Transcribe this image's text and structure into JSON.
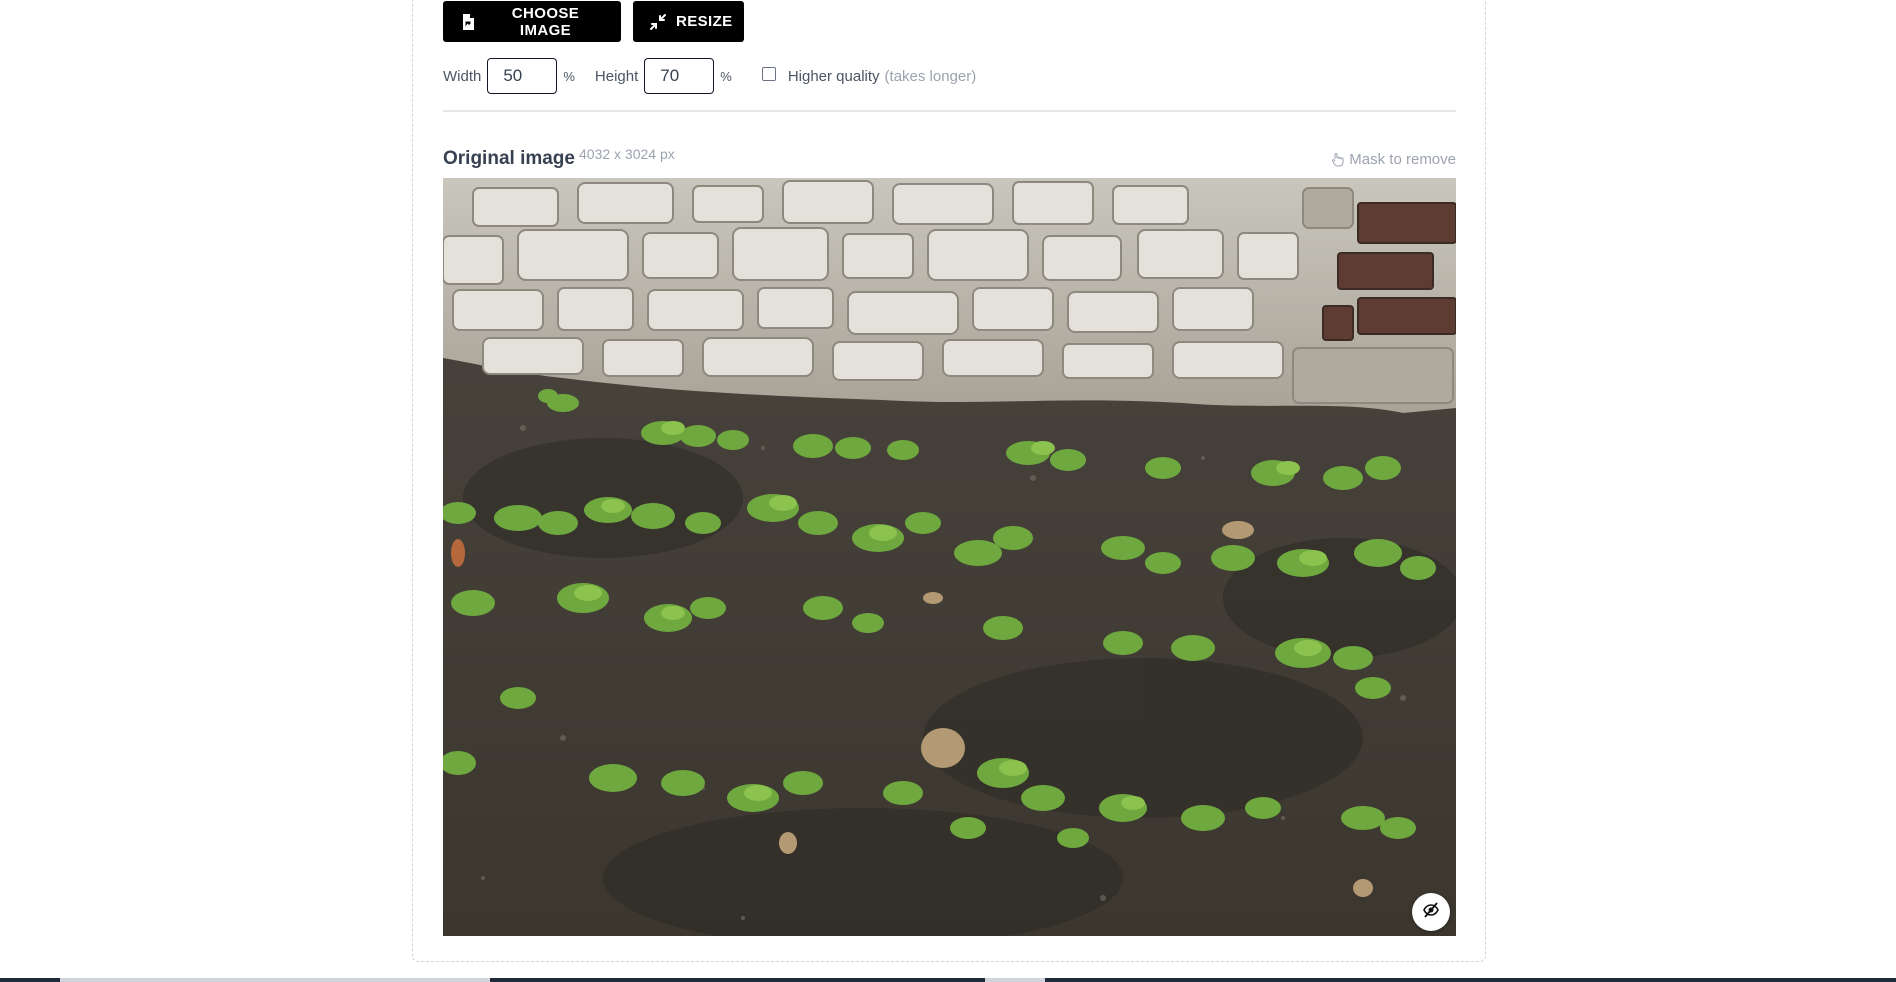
{
  "toolbar": {
    "choose_label": "CHOOSE IMAGE",
    "resize_label": "RESIZE"
  },
  "options": {
    "width_label": "Width",
    "width_value": "50",
    "width_unit": "%",
    "height_label": "Height",
    "height_value": "70",
    "height_unit": "%",
    "quality_label": "Higher quality",
    "quality_note": "(takes longer)",
    "quality_checked": false
  },
  "original": {
    "title": "Original image",
    "dimensions": "4032 x 3024 px",
    "mask_label": "Mask to remove",
    "mask_icon": "pointer-hand-icon",
    "photo_description_icon": "photo-garden-seedlings",
    "hide_icon": "eye-slash-icon"
  },
  "colors": {
    "button_bg": "#000000",
    "text": "#374151",
    "muted": "#9ca3af"
  }
}
